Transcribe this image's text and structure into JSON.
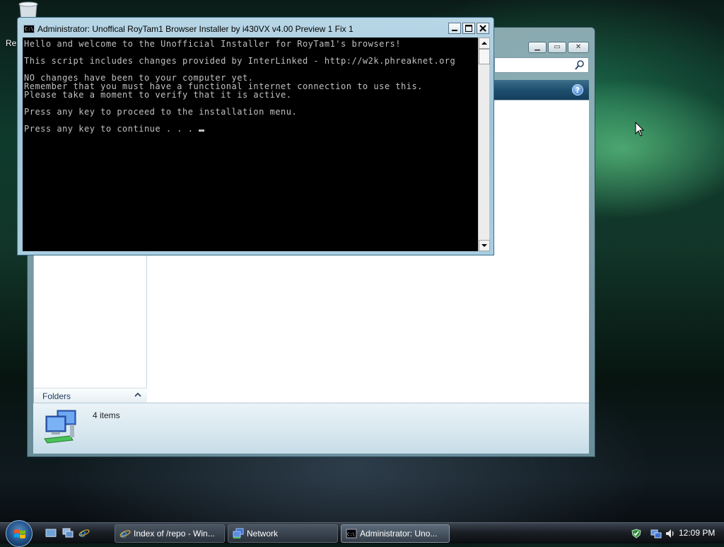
{
  "desktop": {
    "recycle_bin_label": "Re"
  },
  "console": {
    "title": "Administrator:  Unoffical RoyTam1 Browser Installer by i430VX v4.00 Preview 1 Fix 1",
    "lines": [
      "Hello and welcome to the Unofficial Installer for RoyTam1's browsers!",
      "",
      "This script includes changes provided by InterLinked - http://w2k.phreaknet.org",
      "",
      "NO changes have been to your computer yet.",
      "Remember that you must have a functional internet connection to use this.",
      "Please take a moment to verify that it is active.",
      "",
      "Press any key to proceed to the installation menu.",
      "",
      "Press any key to continue . . . "
    ]
  },
  "explorer": {
    "folders_label": "Folders",
    "status_count": "4 items"
  },
  "taskbar": {
    "buttons": [
      {
        "label": "Index of /repo - Win...",
        "icon": "ie-icon"
      },
      {
        "label": "Network",
        "icon": "network-icon"
      },
      {
        "label": "Administrator:  Uno...",
        "icon": "cmd-icon"
      }
    ],
    "clock": "12:09 PM"
  }
}
